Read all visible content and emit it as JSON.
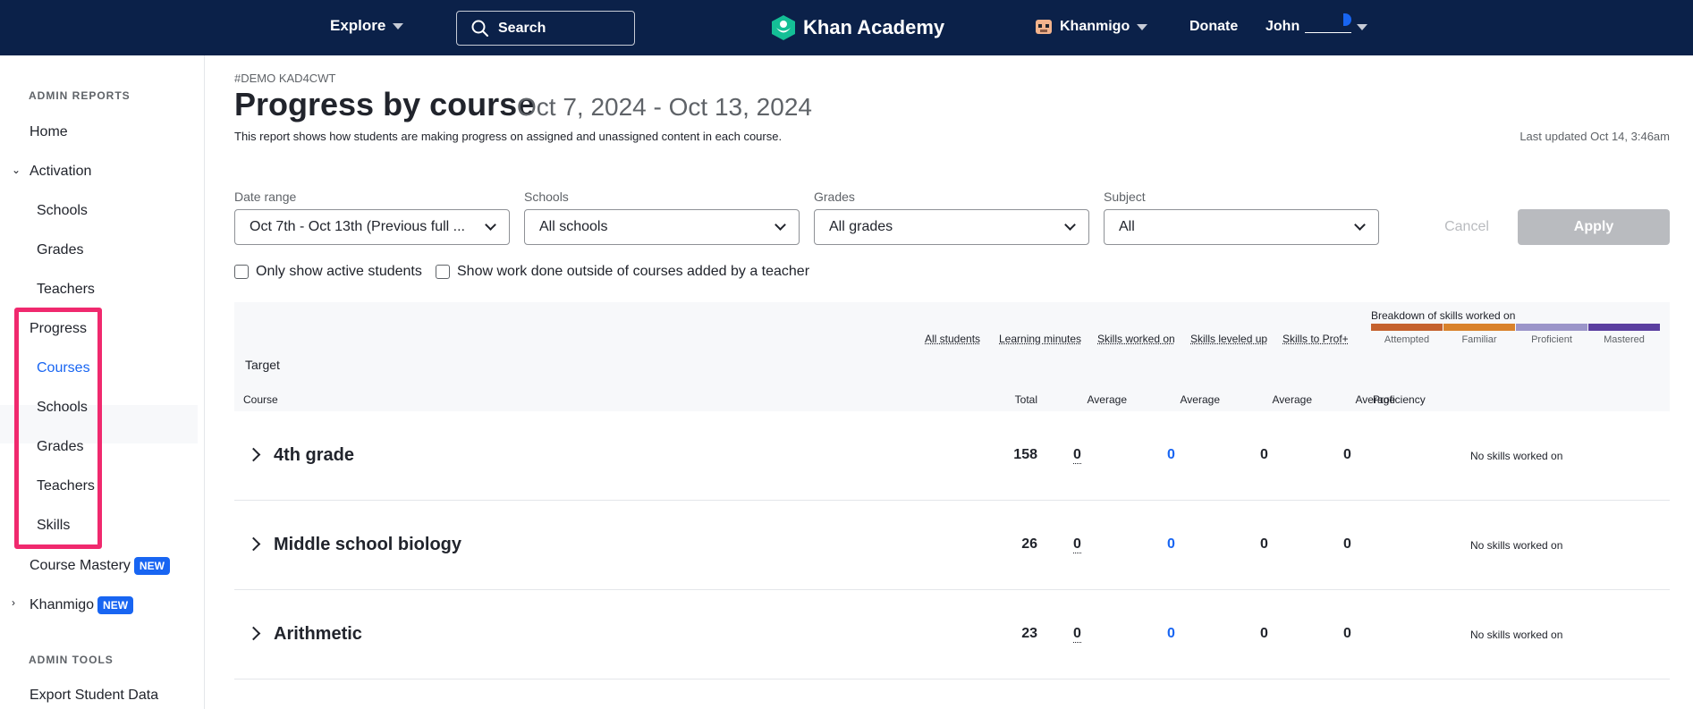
{
  "topnav": {
    "explore": "Explore",
    "search": "Search",
    "logo": "Khan Academy",
    "khanmigo": "Khanmigo",
    "donate": "Donate",
    "user": "John"
  },
  "sidebar": {
    "admin_reports": "ADMIN REPORTS",
    "home": "Home",
    "activation": "Activation",
    "activation_items": [
      "Schools",
      "Grades",
      "Teachers"
    ],
    "progress": "Progress",
    "progress_items": [
      "Courses",
      "Schools",
      "Grades",
      "Teachers",
      "Skills"
    ],
    "course_mastery": "Course Mastery",
    "khanmigo": "Khanmigo",
    "new_badge": "NEW",
    "admin_tools": "ADMIN TOOLS",
    "export": "Export Student Data"
  },
  "header": {
    "demo_tag": "#DEMO KAD4CWT",
    "title": "Progress by course",
    "date_range": "Oct 7, 2024 - Oct 13, 2024",
    "description": "This report shows how students are making progress on assigned and unassigned content in each course.",
    "last_updated": "Last updated Oct 14, 3:46am"
  },
  "filters": {
    "date_range_label": "Date range",
    "date_range_value": "Oct 7th - Oct 13th (Previous full ...",
    "schools_label": "Schools",
    "schools_value": "All schools",
    "grades_label": "Grades",
    "grades_value": "All grades",
    "subject_label": "Subject",
    "subject_value": "All",
    "cancel": "Cancel",
    "apply": "Apply",
    "only_active": "Only show active students",
    "outside_work": "Show work done outside of courses added by a teacher"
  },
  "table": {
    "target": "Target",
    "course": "Course",
    "columns": [
      "All students",
      "Learning minutes",
      "Skills worked on",
      "Skills leveled up",
      "Skills to Prof+"
    ],
    "subheads": [
      "Total",
      "Average",
      "Average",
      "Average",
      "Average",
      "Proficiency"
    ],
    "breakdown_title": "Breakdown of skills worked on",
    "breakdown_legend": [
      {
        "label": "Attempted",
        "color": "#c5622e"
      },
      {
        "label": "Familiar",
        "color": "#d9822b"
      },
      {
        "label": "Proficient",
        "color": "#9b95c9"
      },
      {
        "label": "Mastered",
        "color": "#5b3fa0"
      }
    ],
    "rows": [
      {
        "name": "4th grade",
        "total": "158",
        "minutes": "0",
        "worked": "0",
        "leveled": "0",
        "prof": "0",
        "note": "No skills worked on"
      },
      {
        "name": "Middle school biology",
        "total": "26",
        "minutes": "0",
        "worked": "0",
        "leveled": "0",
        "prof": "0",
        "note": "No skills worked on"
      },
      {
        "name": "Arithmetic",
        "total": "23",
        "minutes": "0",
        "worked": "0",
        "leveled": "0",
        "prof": "0",
        "note": "No skills worked on"
      }
    ]
  }
}
